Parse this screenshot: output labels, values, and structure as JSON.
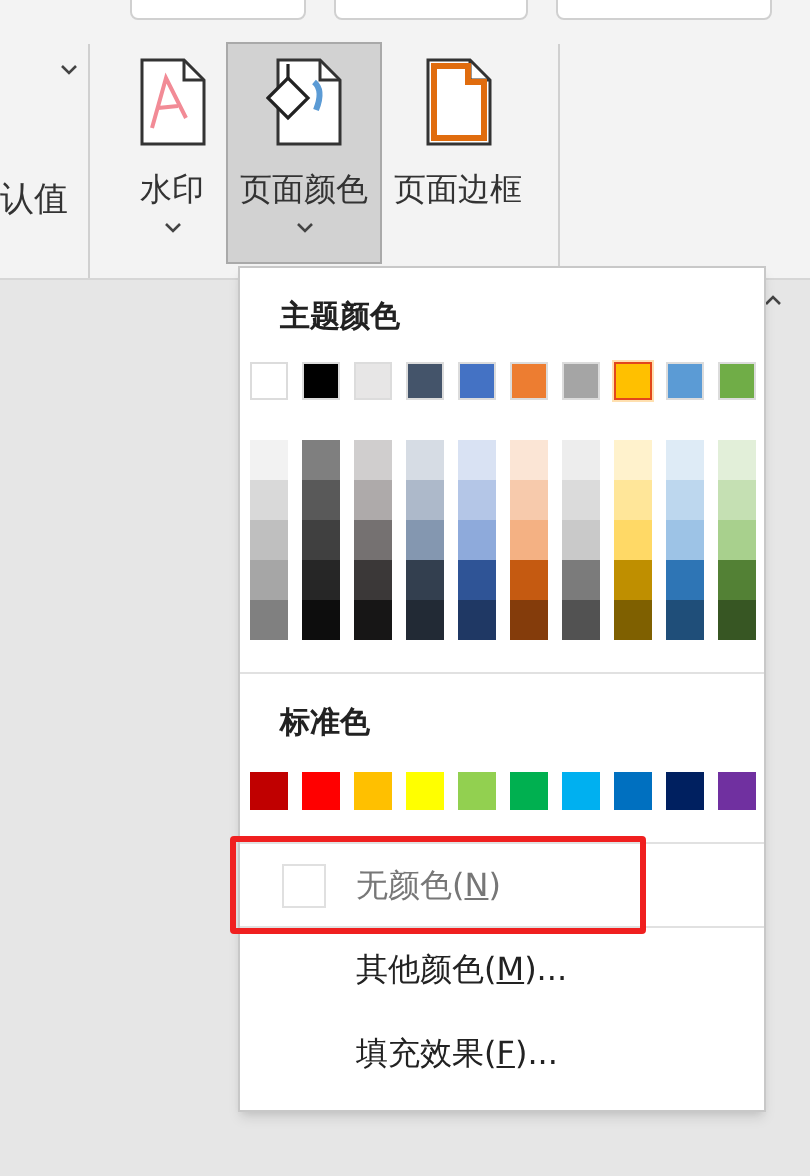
{
  "ribbon": {
    "left_labels": [
      {
        "text": "认值"
      }
    ],
    "buttons": [
      {
        "kind": "watermark",
        "label": "水印",
        "dropdown": true,
        "selected": false
      },
      {
        "kind": "page_color",
        "label": "页面颜色",
        "dropdown": true,
        "selected": true
      },
      {
        "kind": "page_border",
        "label": "页面边框",
        "dropdown": false,
        "selected": false
      }
    ]
  },
  "color_menu": {
    "theme_title": "主题颜色",
    "theme_colors": [
      {
        "color": "#ffffff",
        "selected": false,
        "shades": [
          {
            "color": "#f2f2f2"
          },
          {
            "color": "#d9d9d9"
          },
          {
            "color": "#bfbfbf"
          },
          {
            "color": "#a6a6a6"
          },
          {
            "color": "#808080"
          }
        ]
      },
      {
        "color": "#000000",
        "selected": false,
        "shades": [
          {
            "color": "#7f7f7f"
          },
          {
            "color": "#595959"
          },
          {
            "color": "#404040"
          },
          {
            "color": "#262626"
          },
          {
            "color": "#0d0d0d"
          }
        ]
      },
      {
        "color": "#e7e6e6",
        "selected": false,
        "shades": [
          {
            "color": "#d0cece"
          },
          {
            "color": "#aeaaaa"
          },
          {
            "color": "#757171"
          },
          {
            "color": "#3b3838"
          },
          {
            "color": "#171616"
          }
        ]
      },
      {
        "color": "#44546a",
        "selected": false,
        "shades": [
          {
            "color": "#d6dce4"
          },
          {
            "color": "#adb9ca"
          },
          {
            "color": "#8497b0"
          },
          {
            "color": "#333f4f"
          },
          {
            "color": "#222a35"
          }
        ]
      },
      {
        "color": "#4472c4",
        "selected": false,
        "shades": [
          {
            "color": "#d9e2f3"
          },
          {
            "color": "#b4c6e7"
          },
          {
            "color": "#8eaadb"
          },
          {
            "color": "#2f5496"
          },
          {
            "color": "#1f3864"
          }
        ]
      },
      {
        "color": "#ed7d31",
        "selected": false,
        "shades": [
          {
            "color": "#fbe5d5"
          },
          {
            "color": "#f7caac"
          },
          {
            "color": "#f4b183"
          },
          {
            "color": "#c55a11"
          },
          {
            "color": "#843c0b"
          }
        ]
      },
      {
        "color": "#a5a5a5",
        "selected": false,
        "shades": [
          {
            "color": "#ededed"
          },
          {
            "color": "#dbdbdb"
          },
          {
            "color": "#c9c9c9"
          },
          {
            "color": "#7b7b7b"
          },
          {
            "color": "#525252"
          }
        ]
      },
      {
        "color": "#ffc000",
        "selected": true,
        "shades": [
          {
            "color": "#fff2cc"
          },
          {
            "color": "#ffe699"
          },
          {
            "color": "#ffd966"
          },
          {
            "color": "#bf8f00"
          },
          {
            "color": "#7f6000"
          }
        ]
      },
      {
        "color": "#5b9bd5",
        "selected": false,
        "shades": [
          {
            "color": "#deebf6"
          },
          {
            "color": "#bdd7ee"
          },
          {
            "color": "#9dc3e6"
          },
          {
            "color": "#2e75b5"
          },
          {
            "color": "#1f4e79"
          }
        ]
      },
      {
        "color": "#70ad47",
        "selected": false,
        "shades": [
          {
            "color": "#e2efd9"
          },
          {
            "color": "#c5e0b3"
          },
          {
            "color": "#a8d08d"
          },
          {
            "color": "#538135"
          },
          {
            "color": "#375623"
          }
        ]
      }
    ],
    "standard_title": "标准色",
    "standard_colors": [
      {
        "color": "#c00000"
      },
      {
        "color": "#ff0000"
      },
      {
        "color": "#ffc000"
      },
      {
        "color": "#ffff00"
      },
      {
        "color": "#92d050"
      },
      {
        "color": "#00b050"
      },
      {
        "color": "#00b0f0"
      },
      {
        "color": "#0070c0"
      },
      {
        "color": "#002060"
      },
      {
        "color": "#7030a0"
      }
    ],
    "items": [
      {
        "kind": "no_color",
        "label": "无颜色(N)",
        "mnemonic_underlined": true,
        "disabled": true,
        "highlighted": true
      },
      {
        "kind": "plain",
        "label": "其他颜色(M)...",
        "mnemonic_underlined": true,
        "disabled": false,
        "highlighted": false
      },
      {
        "kind": "plain",
        "label": "填充效果(F)...",
        "mnemonic_underlined": true,
        "disabled": false,
        "highlighted": false
      }
    ]
  }
}
